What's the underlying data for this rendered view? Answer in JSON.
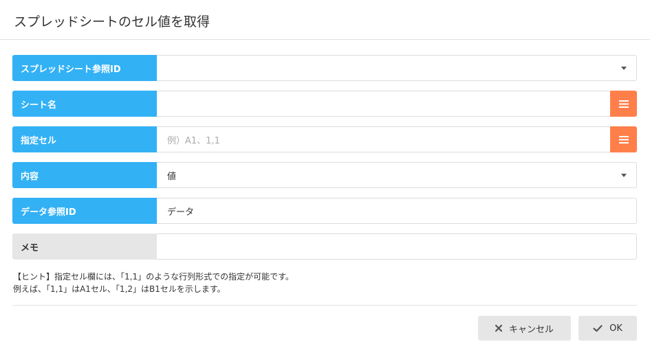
{
  "dialog": {
    "title": "スプレッドシートのセル値を取得"
  },
  "fields": [
    {
      "label": "スプレッドシート参照ID",
      "value": "",
      "control": "select"
    },
    {
      "label": "シート名",
      "value": "",
      "control": "text-with-menu"
    },
    {
      "label": "指定セル",
      "value": "",
      "placeholder": "例）A1、1,1",
      "control": "text-with-menu"
    },
    {
      "label": "内容",
      "value": "値",
      "control": "select"
    },
    {
      "label": "データ参照ID",
      "value": "データ",
      "control": "text"
    },
    {
      "label": "メモ",
      "value": "",
      "control": "text"
    }
  ],
  "hint": {
    "line1": "【ヒント】指定セル欄には、「1,1」のような行列形式での指定が可能です。",
    "line2": "例えば、「1,1」はA1セル、「1,2」はB1セルを示します。"
  },
  "buttons": {
    "cancel": "キャンセル",
    "ok": "OK"
  },
  "colors": {
    "label_bg": "#33b1f5",
    "memo_label_bg": "#e6e6e6",
    "menu_button": "#ff7f4a",
    "button_bg": "#e6e6e6"
  }
}
